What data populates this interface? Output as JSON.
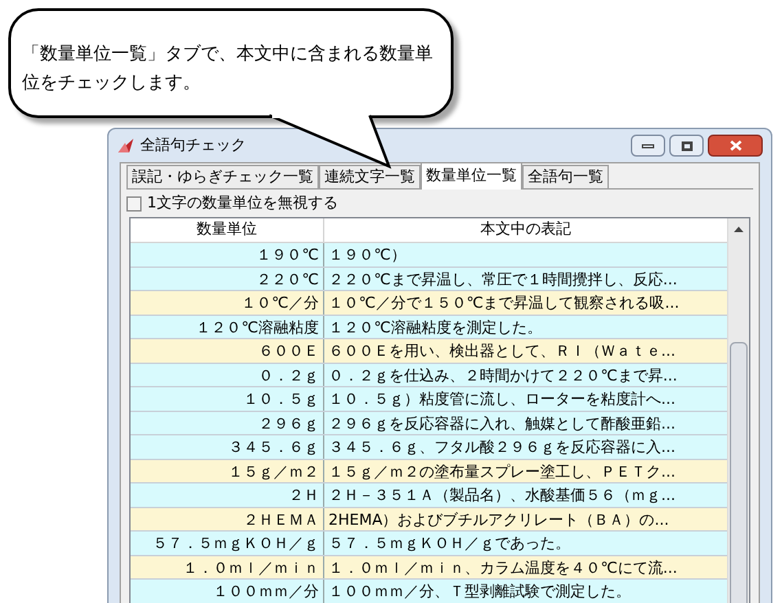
{
  "callout": {
    "text": "「数量単位一覧」タブで、本文中に含まれる数量単位をチェックします。"
  },
  "window": {
    "title": "全語句チェック"
  },
  "tabs": [
    {
      "label": "誤記・ゆらぎチェック一覧",
      "selected": false
    },
    {
      "label": "連続文字一覧",
      "selected": false
    },
    {
      "label": "数量単位一覧",
      "selected": true
    },
    {
      "label": "全語句一覧",
      "selected": false
    }
  ],
  "options": [
    {
      "label": "1文字の数量単位を無視する",
      "checked": false
    }
  ],
  "table": {
    "columns": [
      "数量単位",
      "本文中の表記"
    ],
    "rows": [
      {
        "unit": "１９０℃",
        "context": "１９０℃）",
        "color": "#d8fafd"
      },
      {
        "unit": "２２０℃",
        "context": "２２０℃まで昇温し、常圧で１時間攪拌し、反応...",
        "color": "#d8fafd"
      },
      {
        "unit": "１０℃／分",
        "context": "１０℃／分で１５０℃まで昇温して観察される吸...",
        "color": "#fdf6d2"
      },
      {
        "unit": "１２０℃溶融粘度",
        "context": "１２０℃溶融粘度を測定した。",
        "color": "#d8fafd"
      },
      {
        "unit": "６００Ｅ",
        "context": "６００Ｅを用い、検出器として、ＲＩ（Ｗａｔｅ...",
        "color": "#fdf6d2"
      },
      {
        "unit": "０．２ｇ",
        "context": "０．２ｇを仕込み、２時間かけて２２０℃まで昇...",
        "color": "#d8fafd"
      },
      {
        "unit": "１０．５ｇ",
        "context": "１０．５ｇ）粘度管に流し、ローターを粘度計へ...",
        "color": "#d8fafd"
      },
      {
        "unit": "２９６ｇ",
        "context": "２９６ｇを反応容器に入れ、触媒として酢酸亜鉛...",
        "color": "#d8fafd"
      },
      {
        "unit": "３４５．６ｇ",
        "context": "３４５．６ｇ、フタル酸２９６ｇを反応容器に入...",
        "color": "#d8fafd"
      },
      {
        "unit": "１５ｇ／ｍ２",
        "context": "１５ｇ／ｍ２の塗布量スプレー塗工し、ＰＥＴク...",
        "color": "#fdf6d2"
      },
      {
        "unit": "２Ｈ",
        "context": "２Ｈ－３５１Ａ（製品名）、水酸基価５６（ｍｇ...",
        "color": "#d8fafd"
      },
      {
        "unit": "２ＨＥＭＡ",
        "context": "2HEMA）およびブチルアクリレート（ＢＡ）の...",
        "color": "#fdf6d2"
      },
      {
        "unit": "５７．５ｍｇＫＯＨ／ｇ",
        "context": "５７．５ｍｇＫＯＨ／ｇであった。",
        "color": "#d8fafd"
      },
      {
        "unit": "１．０ｍｌ／ｍｉｎ",
        "context": "１．０ｍｌ／ｍｉｎ、カラム温度を４０℃にて流...",
        "color": "#fdf6d2"
      },
      {
        "unit": "１００ｍｍ／分",
        "context": "１００ｍｍ／分、Ｔ型剥離試験で測定した。",
        "color": "#d8fafd"
      }
    ]
  }
}
